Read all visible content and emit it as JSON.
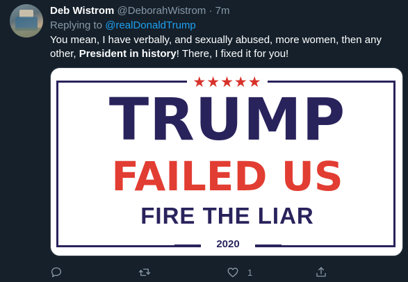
{
  "tweet": {
    "author": {
      "display_name": "Deb Wistrom",
      "handle": "@DeborahWistrom",
      "separator": "·",
      "time": "7m"
    },
    "replying_to": {
      "prefix": "Replying to",
      "mention": "@realDonaldTrump"
    },
    "text": {
      "part1": "You mean, I have verbally, and sexually abused, more women, then any",
      "part2a": "other, ",
      "part2_bold": "President in history",
      "part2b": "! There, I fixed it for you!"
    },
    "media": {
      "stars": "★★★★★",
      "line1": "TRUMP",
      "line2": "FAILED US",
      "line3": "FIRE THE LIAR",
      "year": "2020"
    },
    "actions": {
      "reply_count": "",
      "retweet_count": "",
      "like_count": "1",
      "share_count": ""
    }
  },
  "colors": {
    "background": "#15202b",
    "text_primary": "#ffffff",
    "text_secondary": "#8899a6",
    "link": "#1da1f2",
    "sign_navy": "#29235c",
    "sign_red": "#e23d32"
  },
  "icons": [
    "avatar",
    "reply-icon",
    "retweet-icon",
    "like-icon",
    "share-icon"
  ]
}
